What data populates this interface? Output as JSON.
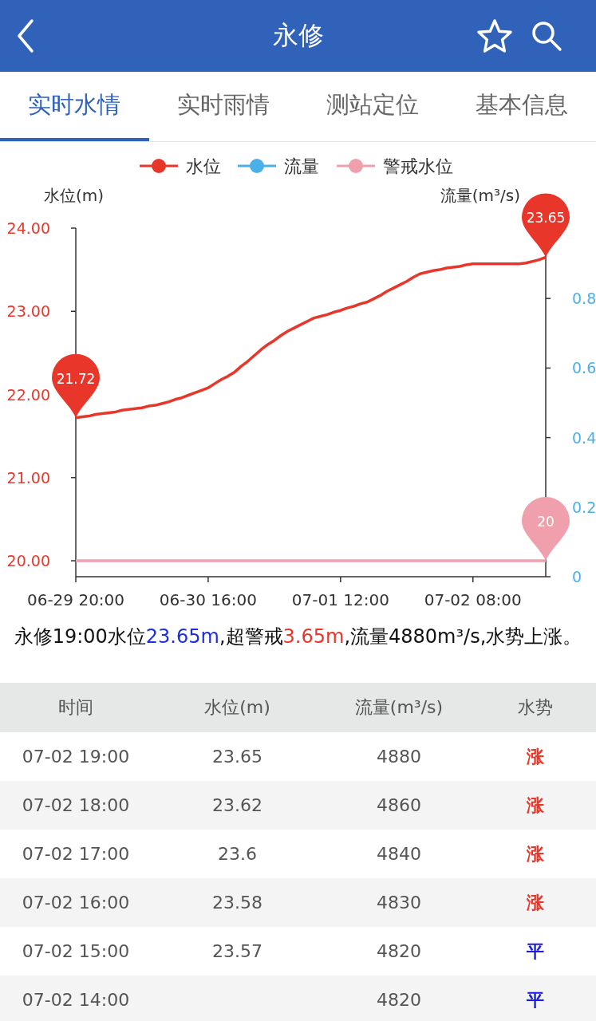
{
  "header": {
    "title": "永修"
  },
  "tabs": [
    {
      "label": "实时水情",
      "selected": true
    },
    {
      "label": "实时雨情",
      "selected": false
    },
    {
      "label": "测站定位",
      "selected": false
    },
    {
      "label": "基本信息",
      "selected": false
    }
  ],
  "chart": {
    "chart_data": {
      "type": "line",
      "ylabel": "水位(m)",
      "y2label": "流量(m³/s)",
      "categories": [
        "06-29 20:00",
        null,
        null,
        null,
        null,
        null,
        null,
        null,
        null,
        null,
        null,
        null,
        null,
        null,
        null,
        null,
        null,
        null,
        null,
        null,
        "06-30 16:00",
        null,
        null,
        null,
        null,
        null,
        null,
        null,
        null,
        null,
        null,
        null,
        null,
        null,
        null,
        null,
        null,
        null,
        null,
        null,
        "07-01 12:00",
        null,
        null,
        null,
        null,
        null,
        null,
        null,
        null,
        null,
        null,
        null,
        null,
        null,
        null,
        null,
        null,
        null,
        null,
        null,
        "07-02 08:00",
        null,
        null,
        null,
        null,
        null,
        null,
        null,
        null,
        null,
        null,
        null
      ],
      "ylim": [
        20,
        24
      ],
      "yticks": [
        {
          "value": 20,
          "label": "20.00"
        },
        {
          "value": 21,
          "label": "21.00"
        },
        {
          "value": 22,
          "label": "22.00"
        },
        {
          "value": 23,
          "label": "23.00"
        },
        {
          "value": 24,
          "label": "24.00"
        }
      ],
      "y2lim": [
        0,
        1
      ],
      "y2ticks": [
        0,
        0.2,
        0.4,
        0.6,
        0.8
      ],
      "series": [
        {
          "name": "水位",
          "color": "#e8372a",
          "values": [
            21.72,
            21.73,
            21.74,
            21.76,
            21.77,
            21.78,
            21.79,
            21.81,
            21.82,
            21.83,
            21.84,
            21.86,
            21.87,
            21.89,
            21.91,
            21.94,
            21.96,
            21.99,
            22.02,
            22.05,
            22.08,
            22.13,
            22.18,
            22.22,
            22.27,
            22.34,
            22.4,
            22.47,
            22.54,
            22.6,
            22.65,
            22.71,
            22.76,
            22.8,
            22.84,
            22.88,
            22.92,
            22.94,
            22.96,
            22.99,
            23.01,
            23.04,
            23.06,
            23.09,
            23.11,
            23.15,
            23.19,
            23.24,
            23.28,
            23.32,
            23.36,
            23.41,
            23.45,
            23.47,
            23.49,
            23.5,
            23.52,
            23.53,
            23.54,
            23.56,
            23.57,
            23.57,
            23.57,
            23.57,
            23.57,
            23.57,
            23.57,
            23.57,
            23.58,
            23.6,
            23.62,
            23.65
          ]
        },
        {
          "name": "流量",
          "color": "#4cb0e8",
          "values": [
            null,
            null,
            null,
            null,
            null,
            null,
            null,
            null,
            null,
            null,
            null,
            null,
            null,
            null,
            null,
            null,
            null,
            null,
            null,
            null,
            null,
            null,
            null,
            null,
            null,
            null,
            null,
            null,
            null,
            null,
            null,
            null,
            null,
            null,
            null,
            null,
            null,
            null,
            null,
            null,
            null,
            null,
            null,
            null,
            null,
            null,
            null,
            null,
            null,
            null,
            null,
            null,
            null,
            null,
            null,
            null,
            null,
            null,
            null,
            null,
            null,
            null,
            null,
            null,
            null,
            null,
            null,
            null,
            null,
            null,
            null,
            null
          ]
        },
        {
          "name": "警戒水位",
          "color": "#f0a0ad",
          "values": [
            20,
            20,
            20,
            20,
            20,
            20,
            20,
            20,
            20,
            20,
            20,
            20,
            20,
            20,
            20,
            20,
            20,
            20,
            20,
            20,
            20,
            20,
            20,
            20,
            20,
            20,
            20,
            20,
            20,
            20,
            20,
            20,
            20,
            20,
            20,
            20,
            20,
            20,
            20,
            20,
            20,
            20,
            20,
            20,
            20,
            20,
            20,
            20,
            20,
            20,
            20,
            20,
            20,
            20,
            20,
            20,
            20,
            20,
            20,
            20,
            20,
            20,
            20,
            20,
            20,
            20,
            20,
            20,
            20,
            20,
            20,
            20
          ]
        }
      ],
      "legend": "top",
      "annotations": [
        {
          "y": 21.72,
          "text": "21.72"
        },
        {
          "y": 23.65,
          "text": "23.65"
        },
        {
          "y": 20,
          "text": "20"
        }
      ]
    }
  },
  "summary": [
    {
      "kind": "plain",
      "text": "永修19:00水位"
    },
    {
      "kind": "level",
      "text": "23.65m"
    },
    {
      "kind": "plain",
      "text": ",超警戒"
    },
    {
      "kind": "over",
      "text": "3.65m"
    },
    {
      "kind": "plain",
      "text": ",流量4880m³/s,水势上涨。"
    }
  ],
  "table": {
    "columns": [
      "时间",
      "水位(m)",
      "流量(m³/s)",
      "水势"
    ],
    "rows": [
      {
        "time": "07-02 19:00",
        "level_m": "23.65",
        "flow": "4880",
        "trend": "涨",
        "kind": "rise"
      },
      {
        "time": "07-02 18:00",
        "level_m": "23.62",
        "flow": "4860",
        "trend": "涨",
        "kind": "rise"
      },
      {
        "time": "07-02 17:00",
        "level_m": "23.6",
        "flow": "4840",
        "trend": "涨",
        "kind": "rise"
      },
      {
        "time": "07-02 16:00",
        "level_m": "23.58",
        "flow": "4830",
        "trend": "涨",
        "kind": "rise"
      },
      {
        "time": "07-02 15:00",
        "level_m": "23.57",
        "flow": "4820",
        "trend": "平",
        "kind": "flat"
      },
      {
        "time": "07-02 14:00",
        "flow": "4820",
        "trend": "平",
        "kind": "flat"
      }
    ]
  }
}
